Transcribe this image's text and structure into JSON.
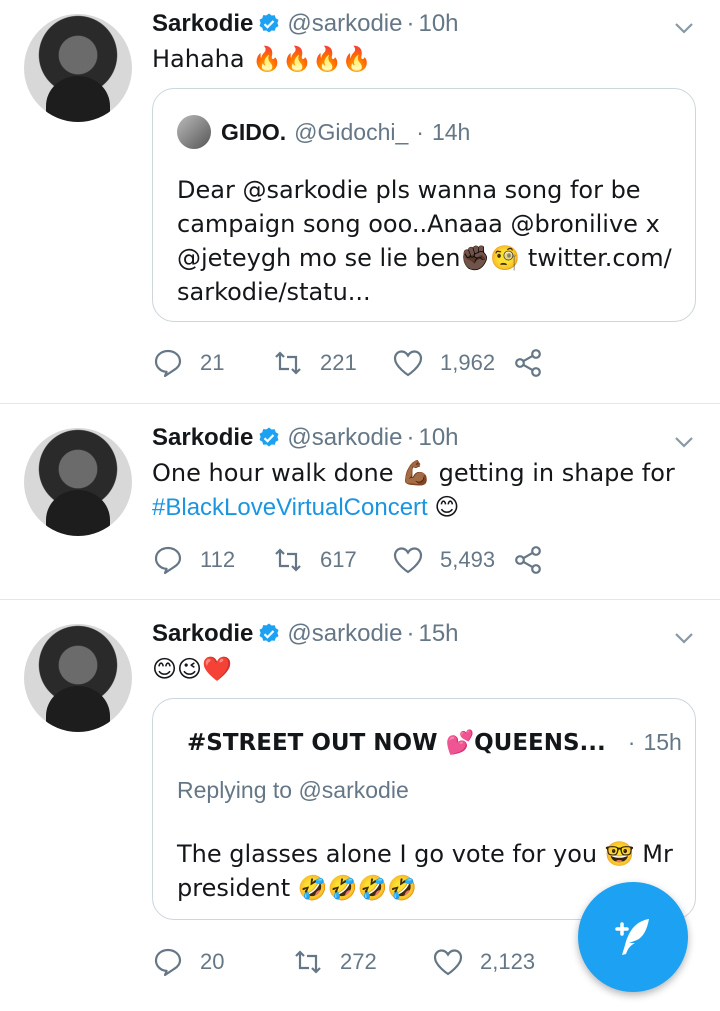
{
  "tweets": [
    {
      "author": "Sarkodie",
      "handle": "@sarkodie",
      "dot": "·",
      "time": "10h",
      "text": "Hahaha 🔥🔥🔥🔥",
      "quote": {
        "name": "GIDO.",
        "handle": "@Gidochi_",
        "dot": "·",
        "time": "14h",
        "text": "Dear @sarkodie pls wanna song for be\ncampaign song ooo..Anaaa @bronilive x\n@jeteygh mo se lie ben✊🏿🧐 twitter.com/\nsarkodie/statu..."
      },
      "replies": "21",
      "retweets": "221",
      "likes": "1,962"
    },
    {
      "author": "Sarkodie",
      "handle": "@sarkodie",
      "dot": "·",
      "time": "10h",
      "text_line1": "One hour walk done 💪🏾 getting in shape for",
      "text_hashtag": "#BlackLoveVirtualConcert",
      "text_emoji": "😊",
      "replies": "112",
      "retweets": "617",
      "likes": "5,493"
    },
    {
      "author": "Sarkodie",
      "handle": "@sarkodie",
      "dot": "·",
      "time": "15h",
      "text": "😊😉❤️",
      "quote": {
        "name": "#STREET OUT NOW 💕QUEENS...",
        "dot": "·",
        "time": "15h",
        "replying": "Replying to @sarkodie",
        "text": "The glasses alone I go vote for you 🤓 Mr\npresident 🤣🤣🤣🤣"
      },
      "replies": "20",
      "retweets": "272",
      "likes": "2,123"
    }
  ],
  "colors": {
    "accent": "#1da1f2",
    "muted": "#657786",
    "border": "#e1e8ed"
  },
  "icons": [
    "verified-badge-icon",
    "chevron-down-icon",
    "reply-icon",
    "retweet-icon",
    "like-icon",
    "share-icon",
    "compose-tweet-icon"
  ]
}
